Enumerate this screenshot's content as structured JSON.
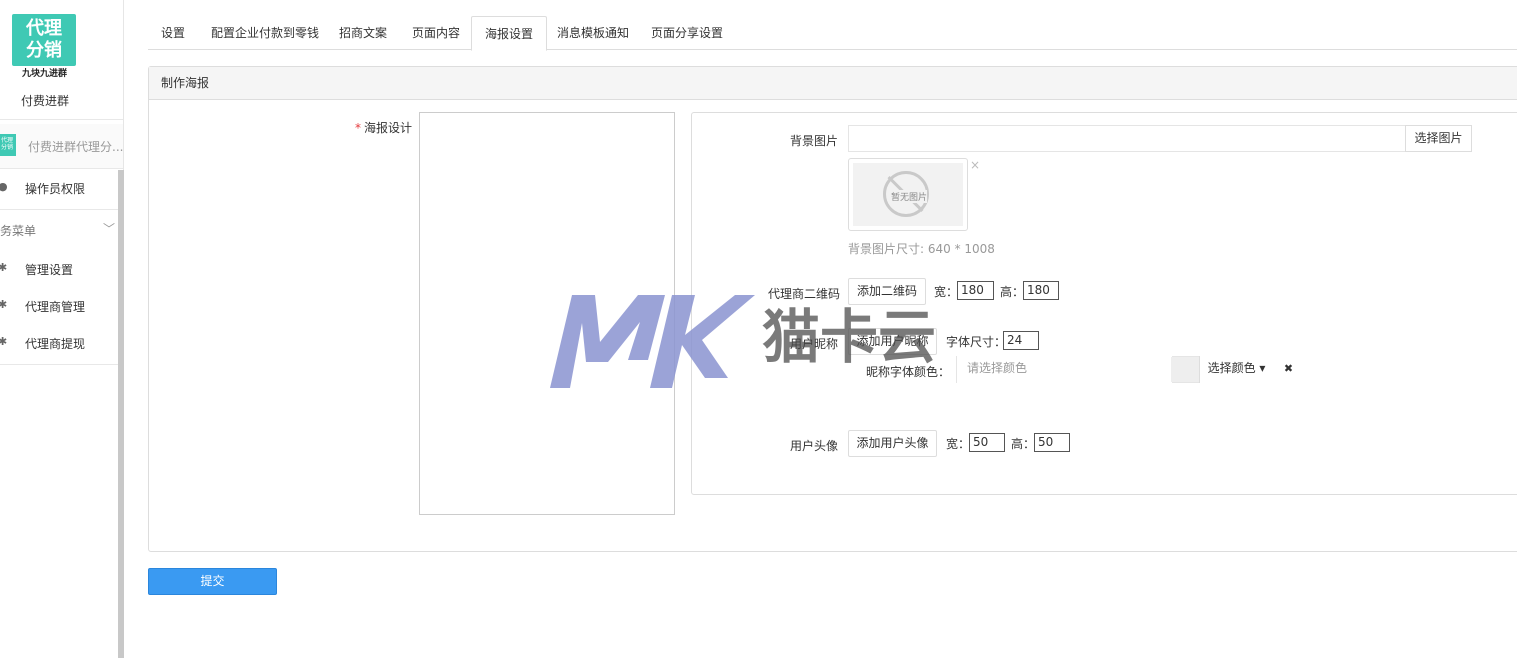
{
  "sidebar": {
    "logo_line1": "代理",
    "logo_line2": "分销",
    "logo_subtitle": "九块九进群",
    "app_name": "付费进群",
    "current_module": "付费进群代理分...",
    "operator_permission": "操作员权限",
    "group_label": "务菜单",
    "items": [
      {
        "label": "管理设置",
        "icon": "gear-icon"
      },
      {
        "label": "代理商管理",
        "icon": "gear-icon"
      },
      {
        "label": "代理商提现",
        "icon": "gear-icon"
      }
    ]
  },
  "tabs": [
    {
      "label": "设置"
    },
    {
      "label": "配置企业付款到零钱"
    },
    {
      "label": "招商文案"
    },
    {
      "label": "页面内容"
    },
    {
      "label": "海报设置",
      "active": true
    },
    {
      "label": "消息模板通知"
    },
    {
      "label": "页面分享设置"
    }
  ],
  "panel": {
    "title": "制作海报",
    "poster_design_label": "海报设计",
    "required_mark": "*"
  },
  "settings": {
    "bg_image_label": "背景图片",
    "bg_image_value": "",
    "select_image_btn": "选择图片",
    "no_image_text": "暂无图片",
    "close_mark": "×",
    "bg_size_hint": "背景图片尺寸: 640 * 1008",
    "agent_qr_label": "代理商二维码",
    "add_qr_btn": "添加二维码",
    "width_label": "宽：",
    "height_label": "高：",
    "qr_width": "180",
    "qr_height": "180",
    "nickname_label": "用户昵称",
    "add_nickname_btn": "添加用户昵称",
    "font_size_label": "字体尺寸：",
    "font_size": "24",
    "nickname_color_label": "昵称字体颜色：",
    "color_placeholder": "请选择颜色",
    "select_color_btn": "选择颜色 ▾",
    "clear_color_mark": "✖",
    "avatar_label": "用户头像",
    "add_avatar_btn": "添加用户头像",
    "avatar_width_label": "宽：",
    "avatar_height_label": "高：",
    "avatar_width": "50",
    "avatar_height": "50"
  },
  "submit_label": "提交",
  "watermark_text": "猫卡云",
  "colors": {
    "accent": "#3a9af2",
    "logo_bg": "#3fc9b4",
    "watermark_blue": "#8a93d0"
  }
}
